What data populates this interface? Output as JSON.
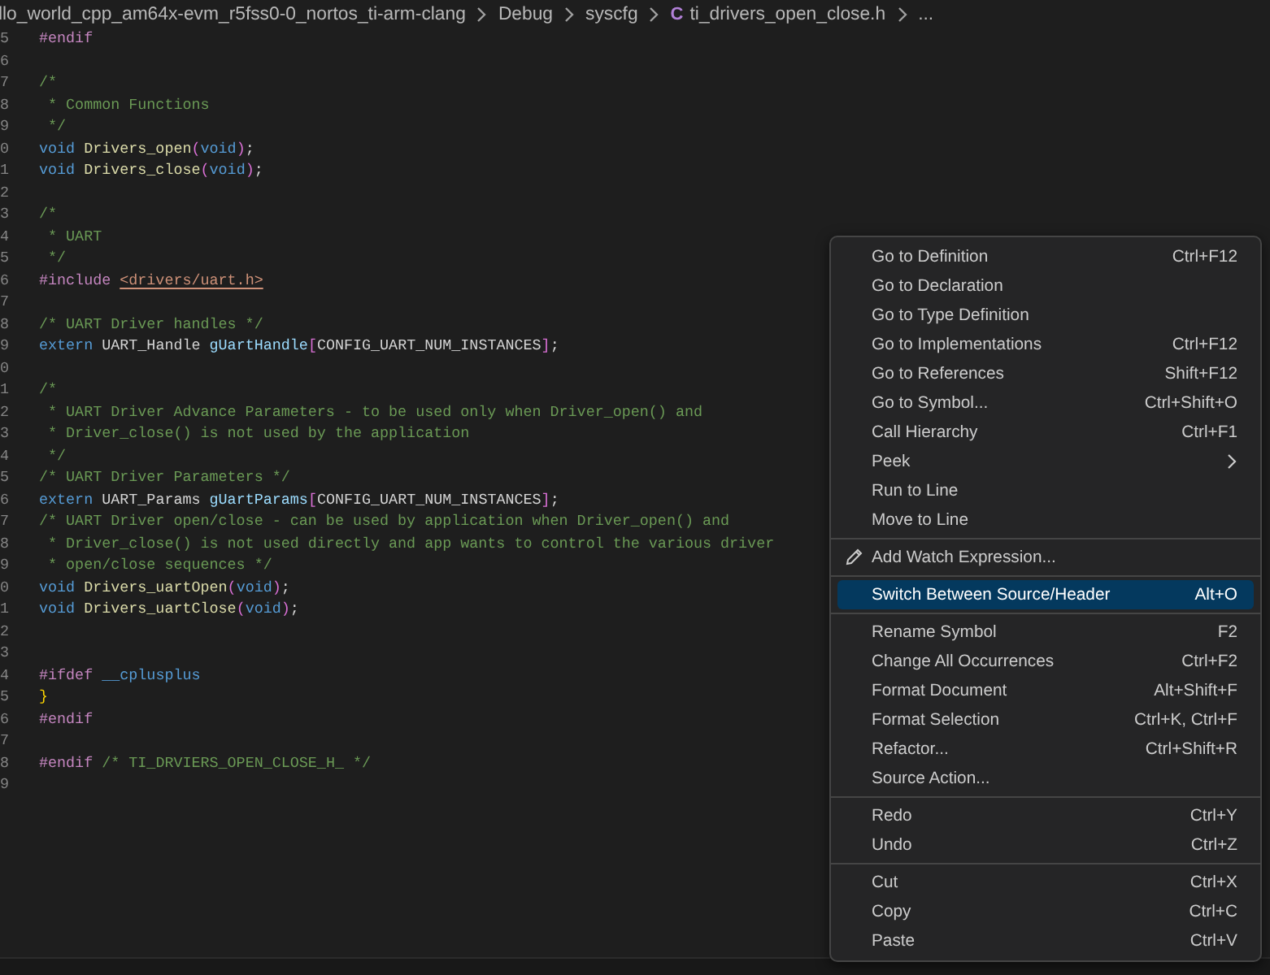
{
  "breadcrumb": {
    "segments": [
      {
        "label": "llo_world_cpp_am64x-evm_r5fss0-0_nortos_ti-arm-clang"
      },
      {
        "label": "Debug"
      },
      {
        "label": "syscfg"
      },
      {
        "label": "ti_drivers_open_close.h",
        "icon_text": "C"
      },
      {
        "label": "..."
      }
    ]
  },
  "editor": {
    "lines": [
      {
        "number": "5",
        "tokens": [
          {
            "kind": "pp",
            "text": "#endif"
          }
        ]
      },
      {
        "number": "6"
      },
      {
        "number": "7",
        "tokens": [
          {
            "kind": "cm",
            "text": "/*"
          }
        ]
      },
      {
        "number": "8",
        "tokens": [
          {
            "kind": "cm",
            "text": " * Common Functions"
          }
        ]
      },
      {
        "number": "9",
        "tokens": [
          {
            "kind": "cm",
            "text": " */"
          }
        ]
      },
      {
        "number": "0",
        "tokens": [
          {
            "kind": "kw",
            "text": "void "
          },
          {
            "kind": "fn",
            "text": "Drivers_open"
          },
          {
            "kind": "br",
            "text": "("
          },
          {
            "kind": "kw",
            "text": "void"
          },
          {
            "kind": "br",
            "text": ")"
          },
          {
            "kind": "id",
            "text": ";"
          }
        ]
      },
      {
        "number": "1",
        "tokens": [
          {
            "kind": "kw",
            "text": "void "
          },
          {
            "kind": "fn",
            "text": "Drivers_close"
          },
          {
            "kind": "br",
            "text": "("
          },
          {
            "kind": "kw",
            "text": "void"
          },
          {
            "kind": "br",
            "text": ")"
          },
          {
            "kind": "id",
            "text": ";"
          }
        ]
      },
      {
        "number": "2"
      },
      {
        "number": "3",
        "tokens": [
          {
            "kind": "cm",
            "text": "/*"
          }
        ]
      },
      {
        "number": "4",
        "tokens": [
          {
            "kind": "cm",
            "text": " * UART"
          }
        ]
      },
      {
        "number": "5",
        "tokens": [
          {
            "kind": "cm",
            "text": " */"
          }
        ]
      },
      {
        "number": "6",
        "tokens": [
          {
            "kind": "pp",
            "text": "#include "
          },
          {
            "kind": "inc",
            "text": "<drivers/uart.h>"
          }
        ]
      },
      {
        "number": "7"
      },
      {
        "number": "8",
        "tokens": [
          {
            "kind": "cm",
            "text": "/* UART Driver handles */"
          }
        ]
      },
      {
        "number": "9",
        "tokens": [
          {
            "kind": "kw",
            "text": "extern "
          },
          {
            "kind": "id",
            "text": "UART_Handle "
          },
          {
            "kind": "var",
            "text": "gUartHandle"
          },
          {
            "kind": "br",
            "text": "["
          },
          {
            "kind": "id",
            "text": "CONFIG_UART_NUM_INSTANCES"
          },
          {
            "kind": "br",
            "text": "]"
          },
          {
            "kind": "id",
            "text": ";"
          }
        ]
      },
      {
        "number": "0"
      },
      {
        "number": "1",
        "tokens": [
          {
            "kind": "cm",
            "text": "/*"
          }
        ]
      },
      {
        "number": "2",
        "tokens": [
          {
            "kind": "cm",
            "text": " * UART Driver Advance Parameters - to be used only when Driver_open() and"
          }
        ]
      },
      {
        "number": "3",
        "tokens": [
          {
            "kind": "cm",
            "text": " * Driver_close() is not used by the application"
          }
        ]
      },
      {
        "number": "4",
        "tokens": [
          {
            "kind": "cm",
            "text": " */"
          }
        ]
      },
      {
        "number": "5",
        "tokens": [
          {
            "kind": "cm",
            "text": "/* UART Driver Parameters */"
          }
        ]
      },
      {
        "number": "6",
        "tokens": [
          {
            "kind": "kw",
            "text": "extern "
          },
          {
            "kind": "id",
            "text": "UART_Params "
          },
          {
            "kind": "var",
            "text": "gUartParams"
          },
          {
            "kind": "br",
            "text": "["
          },
          {
            "kind": "id",
            "text": "CONFIG_UART_NUM_INSTANCES"
          },
          {
            "kind": "br",
            "text": "]"
          },
          {
            "kind": "id",
            "text": ";"
          }
        ]
      },
      {
        "number": "7",
        "tokens": [
          {
            "kind": "cm",
            "text": "/* UART Driver open/close - can be used by application when Driver_open() and"
          }
        ]
      },
      {
        "number": "8",
        "tokens": [
          {
            "kind": "cm",
            "text": " * Driver_close() is not used directly and app wants to control the various driver"
          }
        ]
      },
      {
        "number": "9",
        "tokens": [
          {
            "kind": "cm",
            "text": " * open/close sequences */"
          }
        ]
      },
      {
        "number": "0",
        "tokens": [
          {
            "kind": "kw",
            "text": "void "
          },
          {
            "kind": "fn",
            "text": "Drivers_uartOpen"
          },
          {
            "kind": "br",
            "text": "("
          },
          {
            "kind": "kw",
            "text": "void"
          },
          {
            "kind": "br",
            "text": ")"
          },
          {
            "kind": "id",
            "text": ";"
          }
        ]
      },
      {
        "number": "1",
        "tokens": [
          {
            "kind": "kw",
            "text": "void "
          },
          {
            "kind": "fn",
            "text": "Drivers_uartClose"
          },
          {
            "kind": "br",
            "text": "("
          },
          {
            "kind": "kw",
            "text": "void"
          },
          {
            "kind": "br",
            "text": ")"
          },
          {
            "kind": "id",
            "text": ";"
          }
        ]
      },
      {
        "number": "2"
      },
      {
        "number": "3"
      },
      {
        "number": "4",
        "tokens": [
          {
            "kind": "pp",
            "text": "#ifdef "
          },
          {
            "kind": "kw",
            "text": "__cplusplus"
          }
        ]
      },
      {
        "number": "5",
        "tokens": [
          {
            "kind": "gold",
            "text": "}"
          }
        ]
      },
      {
        "number": "6",
        "tokens": [
          {
            "kind": "pp",
            "text": "#endif"
          }
        ]
      },
      {
        "number": "7"
      },
      {
        "number": "8",
        "tokens": [
          {
            "kind": "pp",
            "text": "#endif"
          },
          {
            "kind": "cm",
            "text": " /* TI_DRVIERS_OPEN_CLOSE_H_ */"
          }
        ]
      },
      {
        "number": "9"
      }
    ]
  },
  "context_menu": {
    "groups": [
      {
        "items": [
          {
            "label": "Go to Definition",
            "shortcut": "Ctrl+F12",
            "kind": "plain",
            "selected": false
          },
          {
            "label": "Go to Declaration",
            "kind": "plain",
            "selected": false
          },
          {
            "label": "Go to Type Definition",
            "kind": "plain",
            "selected": false
          },
          {
            "label": "Go to Implementations",
            "shortcut": "Ctrl+F12",
            "kind": "plain",
            "selected": false
          },
          {
            "label": "Go to References",
            "shortcut": "Shift+F12",
            "kind": "plain",
            "selected": false
          },
          {
            "label": "Go to Symbol...",
            "shortcut": "Ctrl+Shift+O",
            "kind": "plain",
            "selected": false
          },
          {
            "label": "Call Hierarchy",
            "shortcut": "Ctrl+F1",
            "kind": "plain",
            "selected": false
          },
          {
            "label": "Peek",
            "kind": "submenu",
            "selected": false
          },
          {
            "label": "Run to Line",
            "kind": "plain",
            "selected": false
          },
          {
            "label": "Move to Line",
            "kind": "plain",
            "selected": false
          }
        ]
      },
      {
        "items": [
          {
            "label": "Add Watch Expression...",
            "kind": "icon",
            "selected": false
          }
        ]
      },
      {
        "items": [
          {
            "label": "Switch Between Source/Header",
            "shortcut": "Alt+O",
            "kind": "plain",
            "selected": true
          }
        ]
      },
      {
        "items": [
          {
            "label": "Rename Symbol",
            "shortcut": "F2",
            "kind": "plain",
            "selected": false
          },
          {
            "label": "Change All Occurrences",
            "shortcut": "Ctrl+F2",
            "kind": "plain",
            "selected": false
          },
          {
            "label": "Format Document",
            "shortcut": "Alt+Shift+F",
            "kind": "plain",
            "selected": false
          },
          {
            "label": "Format Selection",
            "shortcut": "Ctrl+K, Ctrl+F",
            "kind": "plain",
            "selected": false
          },
          {
            "label": "Refactor...",
            "shortcut": "Ctrl+Shift+R",
            "kind": "plain",
            "selected": false
          },
          {
            "label": "Source Action...",
            "kind": "plain",
            "selected": false
          }
        ]
      },
      {
        "items": [
          {
            "label": "Redo",
            "shortcut": "Ctrl+Y",
            "kind": "plain",
            "selected": false
          },
          {
            "label": "Undo",
            "shortcut": "Ctrl+Z",
            "kind": "plain",
            "selected": false
          }
        ]
      },
      {
        "items": [
          {
            "label": "Cut",
            "shortcut": "Ctrl+X",
            "kind": "plain",
            "selected": false
          },
          {
            "label": "Copy",
            "shortcut": "Ctrl+C",
            "kind": "plain",
            "selected": false
          },
          {
            "label": "Paste",
            "shortcut": "Ctrl+V",
            "kind": "plain",
            "selected": false
          }
        ]
      }
    ]
  }
}
